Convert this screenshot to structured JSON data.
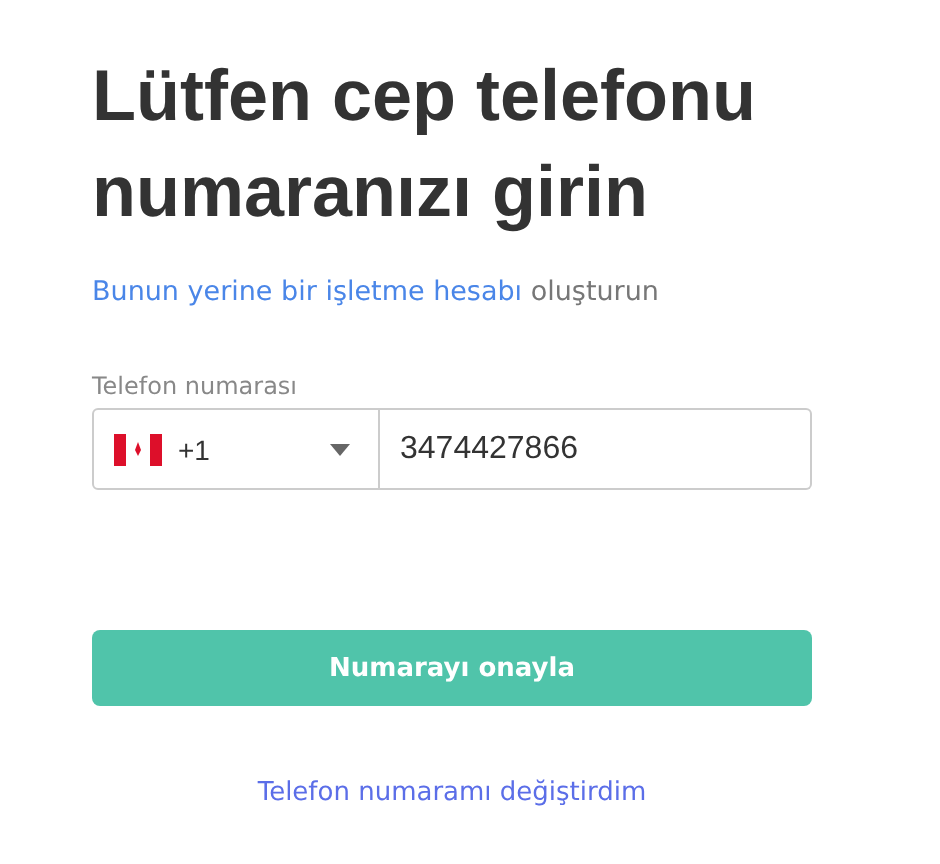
{
  "heading": "Lütfen cep telefonu numaranızı girin",
  "business_prompt": {
    "link": "Bunun yerine bir işletme hesabı",
    "rest": "oluşturun"
  },
  "phone": {
    "label": "Telefon numarası",
    "country_code": "+1",
    "value": "3474427866"
  },
  "confirm_button": "Numarayı onayla",
  "change_link": "Telefon numaramı değiştirdim"
}
